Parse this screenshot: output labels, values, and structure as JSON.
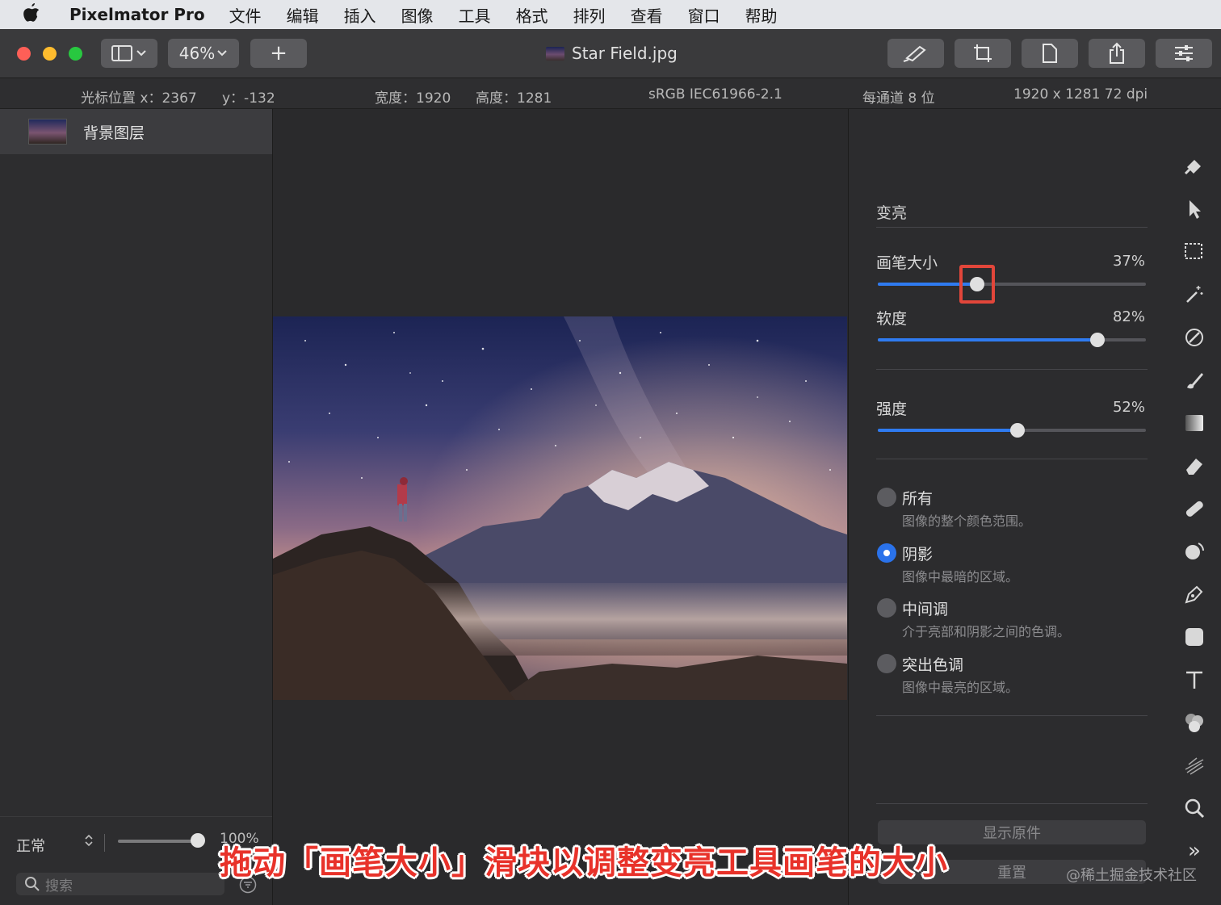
{
  "menubar": {
    "app_name": "Pixelmator Pro",
    "items": [
      "文件",
      "编辑",
      "插入",
      "图像",
      "工具",
      "格式",
      "排列",
      "查看",
      "窗口",
      "帮助"
    ]
  },
  "toolbar": {
    "zoom": "46%",
    "add_label": "+",
    "document_title": "Star Field.jpg"
  },
  "infobar": {
    "cursor_x": "光标位置 x：2367",
    "cursor_y": "y：-132",
    "width": "宽度：1920",
    "height": "高度：1281",
    "color_profile": "sRGB IEC61966-2.1",
    "bit_depth": "每通道 8 位",
    "resolution": "1920 x 1281 72 dpi"
  },
  "layers": {
    "items": [
      {
        "name": "背景图层"
      }
    ],
    "blend_mode": "正常",
    "opacity_label": "100%",
    "opacity_value": 1.0,
    "search_placeholder": "搜索"
  },
  "tool_options": {
    "section_title": "变亮",
    "sliders": [
      {
        "label": "画笔大小",
        "value_label": "37%",
        "value": 0.37
      },
      {
        "label": "软度",
        "value_label": "82%",
        "value": 0.82
      },
      {
        "label": "强度",
        "value_label": "52%",
        "value": 0.52
      }
    ],
    "ranges": [
      {
        "title": "所有",
        "desc": "图像的整个颜色范围。",
        "selected": false
      },
      {
        "title": "阴影",
        "desc": "图像中最暗的区域。",
        "selected": true
      },
      {
        "title": "中间调",
        "desc": "介于亮部和阴影之间的色调。",
        "selected": false
      },
      {
        "title": "突出色调",
        "desc": "图像中最亮的区域。",
        "selected": false
      }
    ],
    "show_original_label": "显示原件",
    "reset_label": "重置"
  },
  "tools": [
    "paint-bucket-icon",
    "arrow-icon",
    "rect-select-icon",
    "magic-wand-icon",
    "color-picker-icon",
    "brush-icon",
    "gradient-icon",
    "eraser-icon",
    "bandage-icon",
    "retouch-icon",
    "pen-icon",
    "shape-icon",
    "text-icon",
    "color-adjust-icon",
    "effects-icon",
    "zoom-icon",
    "more-icon"
  ],
  "more_label": "»",
  "caption": "拖动「画笔大小」滑块以调整变亮工具画笔的大小",
  "watermark": "@稀土掘金技术社区",
  "colors": {
    "accent": "#2f7bf0",
    "highlight": "#e2463a",
    "close": "#fe5f57",
    "minimize": "#febc2e",
    "zoom": "#28c840"
  }
}
